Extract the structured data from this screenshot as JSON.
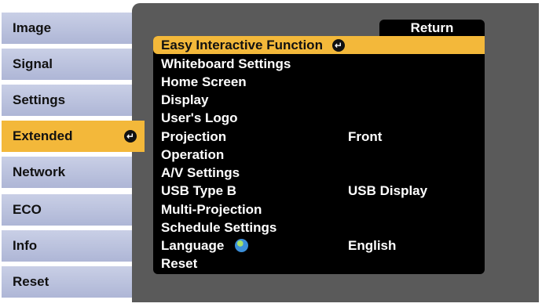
{
  "sidebar": {
    "tabs": [
      {
        "label": "Image",
        "active": false
      },
      {
        "label": "Signal",
        "active": false
      },
      {
        "label": "Settings",
        "active": false
      },
      {
        "label": "Extended",
        "active": true
      },
      {
        "label": "Network",
        "active": false
      },
      {
        "label": "ECO",
        "active": false
      },
      {
        "label": "Info",
        "active": false
      },
      {
        "label": "Reset",
        "active": false
      }
    ]
  },
  "menu": {
    "return_label": "Return",
    "items": [
      {
        "label": "Easy Interactive Function",
        "value": "",
        "selected": true
      },
      {
        "label": "Whiteboard Settings",
        "value": ""
      },
      {
        "label": "Home Screen",
        "value": ""
      },
      {
        "label": "Display",
        "value": ""
      },
      {
        "label": "User's Logo",
        "value": ""
      },
      {
        "label": "Projection",
        "value": "Front"
      },
      {
        "label": "Operation",
        "value": ""
      },
      {
        "label": "A/V Settings",
        "value": ""
      },
      {
        "label": "USB Type B",
        "value": "USB Display"
      },
      {
        "label": "Multi-Projection",
        "value": ""
      },
      {
        "label": "Schedule Settings",
        "value": ""
      },
      {
        "label": "Language",
        "value": "English",
        "icon": "globe-icon"
      },
      {
        "label": "Reset",
        "value": ""
      }
    ]
  },
  "colors": {
    "highlight": "#f3b83a",
    "tab_bg": "#b8bfdc",
    "panel_bg": "#5a5a5a",
    "menu_bg": "#000000"
  }
}
